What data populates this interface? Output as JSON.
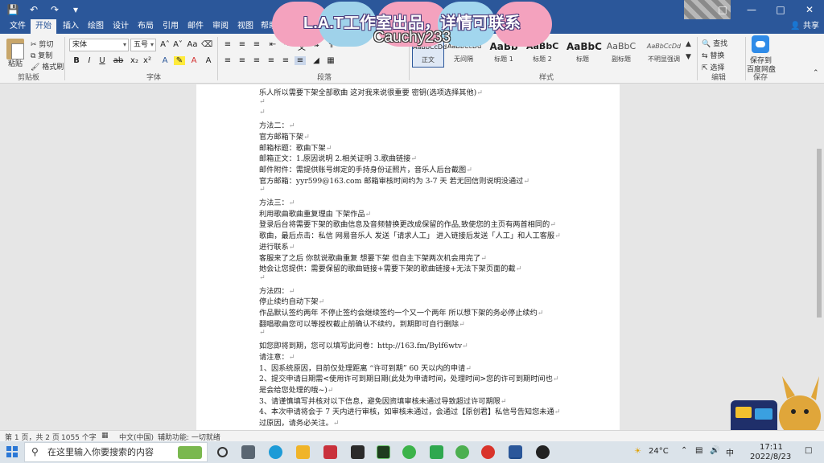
{
  "overlay": {
    "line1": "L.A.T工作室出品，详情可联系",
    "line2": "Cauchy233"
  },
  "tabs": [
    "文件",
    "开始",
    "插入",
    "绘图",
    "设计",
    "布局",
    "引用",
    "邮件",
    "审阅",
    "视图",
    "帮助"
  ],
  "share_label": "共享",
  "ribbon": {
    "clipboard": {
      "paste": "粘贴",
      "cut": "剪切",
      "copy": "复制",
      "format_painter": "格式刷",
      "label": "剪贴板"
    },
    "font": {
      "name": "宋体",
      "size": "五号",
      "label": "字体"
    },
    "paragraph": {
      "label": "段落"
    },
    "styles": {
      "label": "样式",
      "items": [
        {
          "sample": "AaBbCcDd",
          "name": "正文"
        },
        {
          "sample": "AaBbCcDd",
          "name": "无间隔"
        },
        {
          "sample": "AaBb",
          "name": "标题 1"
        },
        {
          "sample": "AaBbC",
          "name": "标题 2"
        },
        {
          "sample": "AaBbC",
          "name": "标题"
        },
        {
          "sample": "AaBbC",
          "name": "副标题"
        },
        {
          "sample": "AaBbCcDd",
          "name": "不明显强调"
        }
      ]
    },
    "editing": {
      "find": "查找",
      "replace": "替换",
      "select": "选择",
      "label": "编辑"
    },
    "save": {
      "line1": "保存到",
      "line2": "百度网盘",
      "label": "保存"
    }
  },
  "document": {
    "lines": [
      "乐人所以需要下架全部歌曲  这对我来说很重要  密钥(选项选择其他)",
      "",
      "",
      "方法二：",
      "官方邮箱下架",
      "邮箱标题：歌曲下架",
      "邮箱正文：1.原因说明  2.相关证明  3.歌曲链接",
      "邮件附件：需提供账号绑定的手持身份证照片，音乐人后台截图",
      "官方邮箱：yyr599@163.com        邮箱审核时间约为 3-7 天  若无回信则说明没通过",
      "",
      "方法三：",
      "利用歌曲歌曲重复理由  下架作品",
      "登录后台将需要下架的歌曲信息及音频替换更改成保留的作品,致使您的主页有两首相同的",
      "歌曲，最后点击：私信 网易音乐人  发送「请求人工」  进入链接后发送「人工」和人工客服",
      "进行联系",
      "客服来了之后  你就说歌曲重复  想要下架  但自主下架两次机会用完了",
      "她会让您提供：需要保留的歌曲链接+需要下架的歌曲链接+无法下架页面的截",
      "",
      "方法四：",
      "停止续约自动下架",
      "作品默认签约两年  不停止签约会继续签约一个又一个两年  所以想下架的务必停止续约",
      "翻唱歌曲您可以等授权截止前确认不续约，到期即可自行删除",
      "",
      "如您即将到期，您可以填写此问卷：http://163.fm/Bylf6wtv",
      "请注意：",
      "1、因系统原因，目前仅处理距离 “许可到期” 60 天以内的申请",
      "2、提交申请日期需<使用许可到期日期(此处为申请时间，处理时间>您的许可到期时间也",
      "是会给您处理的哦~)",
      "3、请谨慎填写并核对以下信息，避免因资填审核未通过导致超过许可期限",
      "4、本次申请将会于 7 天内进行审核，如审核未通过，会通过【原创君】私信号告知您未通",
      "过原因，请务必关注。"
    ]
  },
  "status": {
    "page": "第 1 页，共 2 页",
    "words": "1055 个字",
    "lang": "中文(中国)",
    "accessibility": "辅助功能: 一切就绪"
  },
  "taskbar": {
    "search_placeholder": "在这里输入你要搜索的内容",
    "weather": "24°C",
    "ime": "中",
    "time": "17:11",
    "date": "2022/8/23"
  }
}
